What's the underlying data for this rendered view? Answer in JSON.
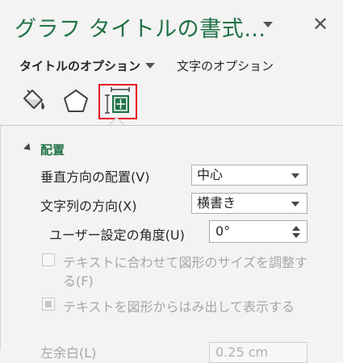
{
  "pane": {
    "title": "グラフ タイトルの書式…"
  },
  "tabs": {
    "options_label": "タイトルのオプション",
    "text_label": "文字のオプション"
  },
  "icons": {
    "fill": "fill-bucket-icon",
    "effects": "pentagon-effects-icon",
    "layout": "size-properties-icon",
    "close": "close-icon"
  },
  "section": {
    "label": "配置"
  },
  "alignment": {
    "vertical_label": "垂直方向の配置(V)",
    "vertical_value": "中心",
    "direction_label": "文字列の方向(X)",
    "direction_value": "横書き",
    "angle_label": "ユーザー設定の角度(U)",
    "angle_value": "0°"
  },
  "checks": {
    "autofit_line1": "テキストに合わせて図形のサイズを調整す",
    "autofit_line2": "る(F)",
    "overflow": "テキストを図形からはみ出して表示する"
  },
  "margins": {
    "left_label": "左余白(L)",
    "left_value": "0.25 cm"
  },
  "colors": {
    "accent": "#217346",
    "highlight": "#e81123"
  }
}
